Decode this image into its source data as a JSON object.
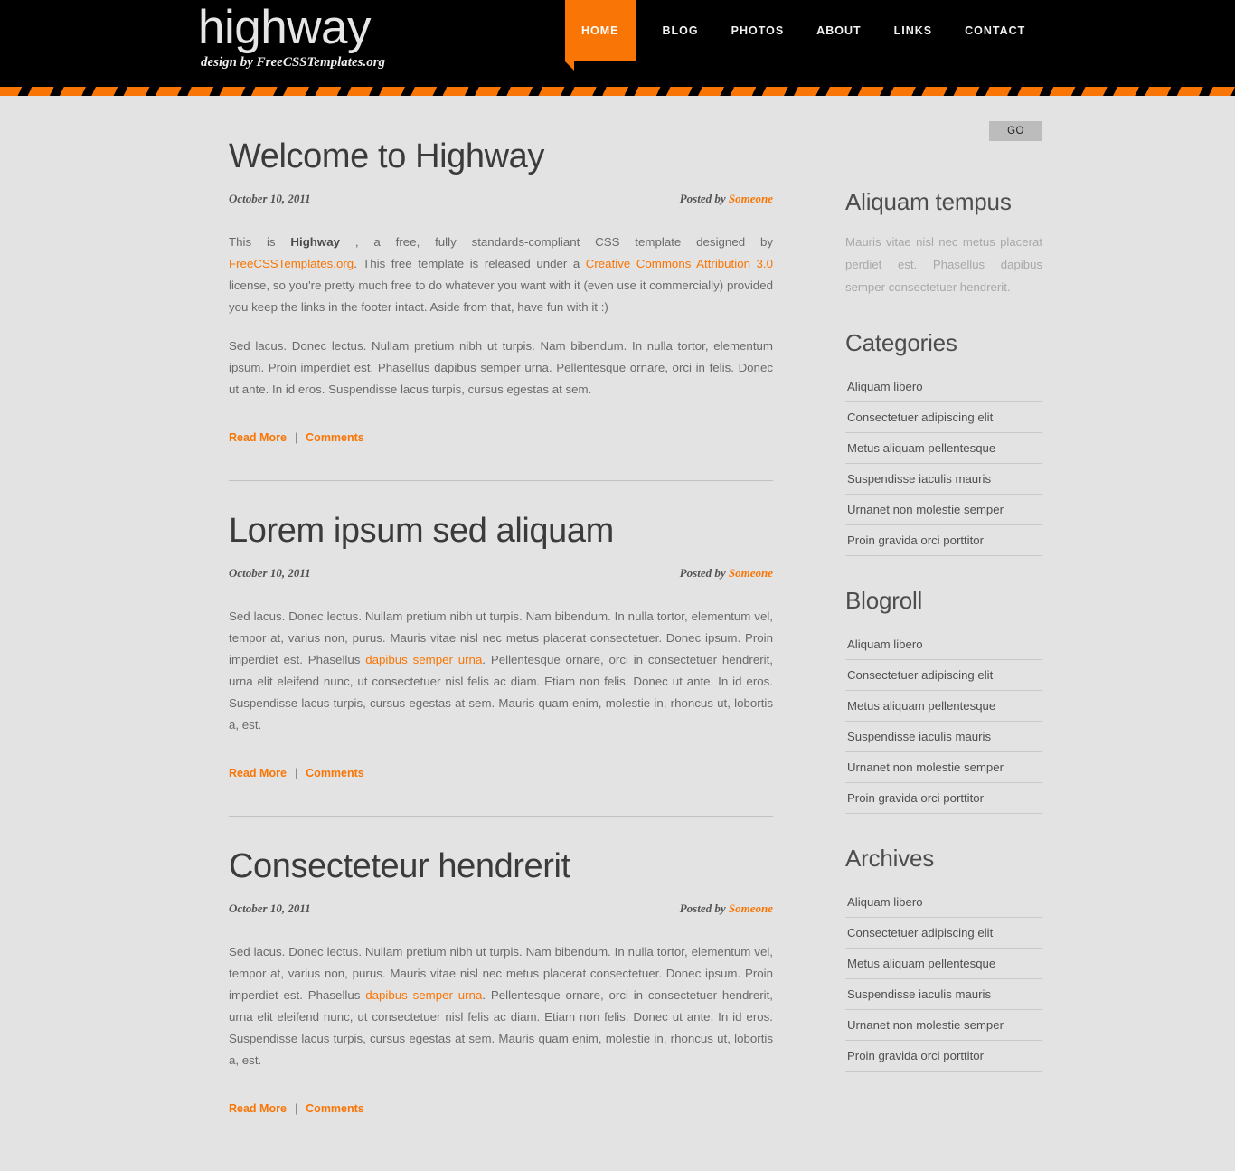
{
  "site": {
    "logo_title": "highway",
    "logo_subtitle": "design by FreeCSSTemplates.org",
    "accent_color": "#f97505",
    "background_color": "#e3e3e3",
    "header_color": "#000000"
  },
  "nav": {
    "items": [
      {
        "label": "HOME",
        "active": true
      },
      {
        "label": "BLOG",
        "active": false
      },
      {
        "label": "PHOTOS",
        "active": false
      },
      {
        "label": "ABOUT",
        "active": false
      },
      {
        "label": "LINKS",
        "active": false
      },
      {
        "label": "CONTACT",
        "active": false
      }
    ]
  },
  "search": {
    "value": "",
    "placeholder": "",
    "button_label": "GO"
  },
  "posts": [
    {
      "title": "Welcome to Highway",
      "date": "October 10, 2011",
      "posted_by_label": "Posted by",
      "author": "Someone",
      "paragraph1_part1": "This is ",
      "paragraph1_bold": "Highway",
      "paragraph1_part2": " , a free, fully standards-compliant CSS template designed by ",
      "paragraph1_link1": "FreeCSSTemplates.org",
      "paragraph1_part3": ". This free template is released under a ",
      "paragraph1_link2": "Creative Commons Attribution 3.0",
      "paragraph1_part4": " license, so you're pretty much free to do whatever you want with it (even use it commercially) provided you keep the links in the footer intact. Aside from that, have fun with it :)",
      "paragraph2": "Sed lacus. Donec lectus. Nullam pretium nibh ut turpis. Nam bibendum. In nulla tortor, elementum ipsum. Proin imperdiet est. Phasellus dapibus semper urna. Pellentesque ornare, orci in felis. Donec ut ante. In id eros. Suspendisse lacus turpis, cursus egestas at sem.",
      "read_more": "Read More",
      "separator": "|",
      "comments": "Comments"
    },
    {
      "title": "Lorem ipsum sed aliquam",
      "date": "October 10, 2011",
      "posted_by_label": "Posted by",
      "author": "Someone",
      "paragraph_part1": "Sed lacus. Donec lectus. Nullam pretium nibh ut turpis. Nam bibendum. In nulla tortor, elementum vel, tempor at, varius non, purus. Mauris vitae nisl nec metus placerat consectetuer. Donec ipsum. Proin imperdiet est. Phasellus ",
      "paragraph_link": "dapibus semper urna",
      "paragraph_part2": ". Pellentesque ornare, orci in consectetuer hendrerit, urna elit eleifend nunc, ut consectetuer nisl felis ac diam. Etiam non felis. Donec ut ante. In id eros. Suspendisse lacus turpis, cursus egestas at sem. Mauris quam enim, molestie in, rhoncus ut, lobortis a, est.",
      "read_more": "Read More",
      "separator": "|",
      "comments": "Comments"
    },
    {
      "title": "Consecteteur hendrerit",
      "date": "October 10, 2011",
      "posted_by_label": "Posted by",
      "author": "Someone",
      "paragraph_part1": "Sed lacus. Donec lectus. Nullam pretium nibh ut turpis. Nam bibendum. In nulla tortor, elementum vel, tempor at, varius non, purus. Mauris vitae nisl nec metus placerat consectetuer. Donec ipsum. Proin imperdiet est. Phasellus ",
      "paragraph_link": "dapibus semper urna",
      "paragraph_part2": ". Pellentesque ornare, orci in consectetuer hendrerit, urna elit eleifend nunc, ut consectetuer nisl felis ac diam. Etiam non felis. Donec ut ante. In id eros. Suspendisse lacus turpis, cursus egestas at sem. Mauris quam enim, molestie in, rhoncus ut, lobortis a, est.",
      "read_more": "Read More",
      "separator": "|",
      "comments": "Comments"
    }
  ],
  "sidebar": {
    "about": {
      "title": "Aliquam tempus",
      "text": "Mauris vitae nisl nec metus placerat perdiet est. Phasellus dapibus semper consectetuer hendrerit."
    },
    "categories": {
      "title": "Categories",
      "items": [
        "Aliquam libero",
        "Consectetuer adipiscing elit",
        "Metus aliquam pellentesque",
        "Suspendisse iaculis mauris",
        "Urnanet non molestie semper",
        "Proin gravida orci porttitor"
      ]
    },
    "blogroll": {
      "title": "Blogroll",
      "items": [
        "Aliquam libero",
        "Consectetuer adipiscing elit",
        "Metus aliquam pellentesque",
        "Suspendisse iaculis mauris",
        "Urnanet non molestie semper",
        "Proin gravida orci porttitor"
      ]
    },
    "archives": {
      "title": "Archives",
      "items": [
        "Aliquam libero",
        "Consectetuer adipiscing elit",
        "Metus aliquam pellentesque",
        "Suspendisse iaculis mauris",
        "Urnanet non molestie semper",
        "Proin gravida orci porttitor"
      ]
    }
  }
}
